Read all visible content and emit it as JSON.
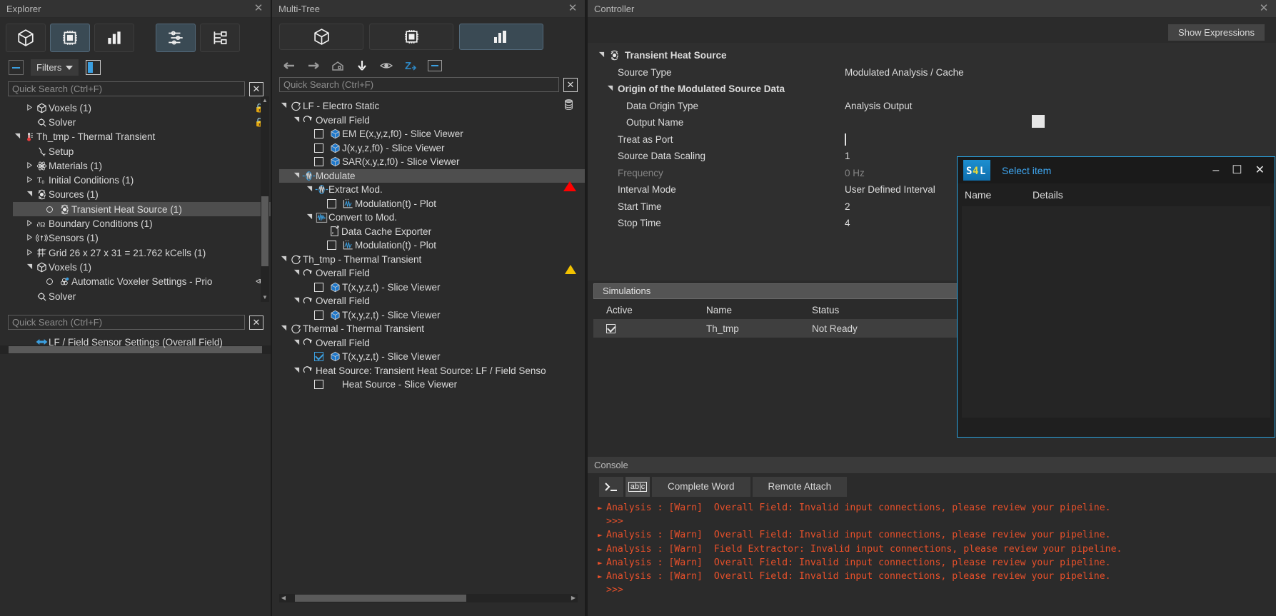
{
  "explorer": {
    "title": "Explorer",
    "tabs": [
      {
        "name": "model-tab",
        "icon": "cube-icon",
        "selected": false
      },
      {
        "name": "simulation-tab",
        "icon": "chip-icon",
        "selected": true
      },
      {
        "name": "results-tab",
        "icon": "bar-chart-icon",
        "selected": false
      },
      {
        "name": "settings-tab",
        "icon": "sliders-icon",
        "selected": true
      },
      {
        "name": "tree-tab",
        "icon": "tree-icon",
        "selected": false
      }
    ],
    "filters_label": "Filters",
    "search_placeholder": "Quick Search (Ctrl+F)",
    "search_value": "",
    "tree": [
      {
        "label": "Voxels (1)",
        "indent": 1,
        "twist": "collapsed",
        "icon": "cube-icon",
        "lock": true
      },
      {
        "label": "Solver",
        "indent": 1,
        "twist": "none",
        "icon": "solver-icon",
        "lock": true
      },
      {
        "label": "Th_tmp - Thermal Transient",
        "indent": 0,
        "twist": "expanded",
        "icon": "thermometer-icon"
      },
      {
        "label": "Setup",
        "indent": 1,
        "twist": "none",
        "icon": "setup-icon"
      },
      {
        "label": "Materials (1)",
        "indent": 1,
        "twist": "collapsed",
        "icon": "atom-icon"
      },
      {
        "label": "Initial Conditions (1)",
        "indent": 1,
        "twist": "collapsed",
        "icon": "t0-icon"
      },
      {
        "label": "Sources (1)",
        "indent": 1,
        "twist": "expanded",
        "icon": "source-icon"
      },
      {
        "label": "Transient Heat Source (1)",
        "indent": 2,
        "twist": "none",
        "icon": "source-icon",
        "radio": true,
        "selected": true
      },
      {
        "label": "Boundary Conditions (1)",
        "indent": 1,
        "twist": "collapsed",
        "icon": "domega-icon"
      },
      {
        "label": "Sensors (1)",
        "indent": 1,
        "twist": "collapsed",
        "icon": "sensor-icon"
      },
      {
        "label": "Grid 26 x 27 x 31 = 21.762 kCells (1)",
        "indent": 1,
        "twist": "collapsed",
        "icon": "grid-icon"
      },
      {
        "label": "Voxels (1)",
        "indent": 1,
        "twist": "expanded",
        "icon": "cube-icon"
      },
      {
        "label": "Automatic Voxeler Settings - Prio",
        "indent": 2,
        "twist": "none",
        "icon": "voxeler-icon",
        "radio": true,
        "eye": true
      },
      {
        "label": "Solver",
        "indent": 1,
        "twist": "none",
        "icon": "solver-icon"
      }
    ],
    "search2_placeholder": "Quick Search (Ctrl+F)",
    "lower_items": [
      {
        "label": "LF / Field Sensor Settings (Overall Field)",
        "icon": "arrows-icon"
      }
    ]
  },
  "multitree": {
    "title": "Multi-Tree",
    "tabs": [
      {
        "name": "model-tab",
        "icon": "cube-icon",
        "selected": false
      },
      {
        "name": "simulation-tab",
        "icon": "chip-icon",
        "selected": false
      },
      {
        "name": "results-tab",
        "icon": "bar-chart-icon",
        "selected": true
      }
    ],
    "toolbar": [
      {
        "name": "back-icon"
      },
      {
        "name": "forward-icon"
      },
      {
        "name": "home-icon"
      },
      {
        "name": "download-icon"
      },
      {
        "name": "eye-icon"
      },
      {
        "name": "z-sort-icon"
      },
      {
        "name": "collapse-icon"
      }
    ],
    "search_placeholder": "Quick Search (Ctrl+F)",
    "search_value": "",
    "tree": [
      {
        "label": "LF - Electro Static",
        "indent": 0,
        "twist": "expanded",
        "icon": "simulation-icon",
        "db": true
      },
      {
        "label": "Overall Field",
        "indent": 1,
        "twist": "expanded",
        "icon": "field-icon"
      },
      {
        "label": "EM E(x,y,z,f0) - Slice Viewer",
        "indent": 2,
        "twist": "none",
        "icon": "slice-icon",
        "check": false
      },
      {
        "label": "J(x,y,z,f0) - Slice Viewer",
        "indent": 2,
        "twist": "none",
        "icon": "slice-icon",
        "check": false
      },
      {
        "label": "SAR(x,y,z,f0) - Slice Viewer",
        "indent": 2,
        "twist": "none",
        "icon": "slice-icon",
        "check": false
      },
      {
        "label": "Modulate",
        "indent": 1,
        "twist": "expanded",
        "icon": "modulate-icon",
        "selected": true,
        "redflag": true
      },
      {
        "label": "Extract Mod.",
        "indent": 2,
        "twist": "expanded",
        "icon": "modulate-icon"
      },
      {
        "label": "Modulation(t) - Plot",
        "indent": 3,
        "twist": "none",
        "icon": "plot-icon",
        "check": false
      },
      {
        "label": "Convert to Mod.",
        "indent": 2,
        "twist": "expanded",
        "icon": "wave-icon"
      },
      {
        "label": "Data Cache Exporter",
        "indent": 3,
        "twist": "none",
        "icon": "export-icon"
      },
      {
        "label": "Modulation(t) - Plot",
        "indent": 3,
        "twist": "none",
        "icon": "plot-icon",
        "check": false
      },
      {
        "label": "Th_tmp - Thermal Transient",
        "indent": 0,
        "twist": "expanded",
        "icon": "simulation-icon",
        "warn": true
      },
      {
        "label": "Overall Field",
        "indent": 1,
        "twist": "expanded",
        "icon": "field-icon"
      },
      {
        "label": "T(x,y,z,t) - Slice Viewer",
        "indent": 2,
        "twist": "none",
        "icon": "slice-icon",
        "check": false
      },
      {
        "label": "Overall Field",
        "indent": 1,
        "twist": "expanded",
        "icon": "field-icon"
      },
      {
        "label": "T(x,y,z,t) - Slice Viewer",
        "indent": 2,
        "twist": "none",
        "icon": "slice-icon",
        "check": false
      },
      {
        "label": "Thermal - Thermal Transient",
        "indent": 0,
        "twist": "expanded",
        "icon": "simulation-icon"
      },
      {
        "label": "Overall Field",
        "indent": 1,
        "twist": "expanded",
        "icon": "field-icon"
      },
      {
        "label": "T(x,y,z,t) - Slice Viewer",
        "indent": 2,
        "twist": "none",
        "icon": "slice-icon",
        "check": true
      },
      {
        "label": "Heat Source: Transient Heat Source: LF / Field Senso",
        "indent": 1,
        "twist": "expanded",
        "icon": "field-icon"
      },
      {
        "label": "Heat Source - Slice Viewer",
        "indent": 2,
        "twist": "none",
        "icon": "",
        "check": false
      }
    ]
  },
  "controller": {
    "title": "Controller",
    "show_expressions_label": "Show Expressions",
    "properties": [
      {
        "name": "Transient Heat Source",
        "value": "",
        "indent": 0,
        "twist": "expanded",
        "header": true,
        "icon": "source-icon"
      },
      {
        "name": "Source Type",
        "value": "Modulated Analysis / Cache",
        "indent": 1
      },
      {
        "name": "Origin of the Modulated Source Data",
        "value": "",
        "indent": 1,
        "twist": "expanded",
        "header": true
      },
      {
        "name": "Data Origin Type",
        "value": "Analysis Output",
        "indent": 2
      },
      {
        "name": "Output Name",
        "value": "",
        "indent": 2,
        "browse": true
      },
      {
        "name": "Treat as Port",
        "value": "",
        "indent": 1,
        "checkbox": true
      },
      {
        "name": "Source Data Scaling",
        "value": "1",
        "indent": 1
      },
      {
        "name": "Frequency",
        "value": "0 Hz",
        "indent": 1,
        "disabled": true
      },
      {
        "name": "Interval Mode",
        "value": "User Defined Interval",
        "indent": 1
      },
      {
        "name": "Start Time",
        "value": "2",
        "indent": 1
      },
      {
        "name": "Stop Time",
        "value": "4",
        "indent": 1
      }
    ],
    "simulations_section": "Simulations",
    "sim_columns": [
      "Active",
      "Name",
      "Status"
    ],
    "sim_rows": [
      {
        "active": true,
        "name": "Th_tmp",
        "status": "Not Ready"
      }
    ]
  },
  "console": {
    "title": "Console",
    "buttons": [
      {
        "name": "terminal-icon",
        "label": ">_",
        "selected": false
      },
      {
        "name": "abc-icon",
        "label": "abc",
        "selected": true
      },
      {
        "name": "complete-word-button",
        "label": "Complete Word"
      },
      {
        "name": "remote-attach-button",
        "label": "Remote Attach"
      }
    ],
    "log": [
      {
        "bullet": true,
        "text": "Analysis : [Warn]  Overall Field: Invalid input connections, please review your pipeline."
      },
      {
        "bullet": false,
        "text": ">>>"
      },
      {
        "bullet": true,
        "text": "Analysis : [Warn]  Overall Field: Invalid input connections, please review your pipeline."
      },
      {
        "bullet": true,
        "text": "Analysis : [Warn]  Field Extractor: Invalid input connections, please review your pipeline."
      },
      {
        "bullet": true,
        "text": "Analysis : [Warn]  Overall Field: Invalid input connections, please review your pipeline."
      },
      {
        "bullet": true,
        "text": "Analysis : [Warn]  Overall Field: Invalid input connections, please review your pipeline."
      },
      {
        "bullet": false,
        "text": ">>>"
      }
    ]
  },
  "dialog": {
    "title": "Select item",
    "logo_text": "S4L",
    "columns": [
      "Name",
      "Details"
    ],
    "minimize_glyph": "–",
    "maximize_glyph": "☐",
    "close_glyph": "✕"
  },
  "colors": {
    "accent": "#3b9fe0",
    "warn": "#e8502a",
    "select": "#4e4e4e",
    "panel": "#2b2b2b",
    "yellow": "#f2c200",
    "red": "#ff0000"
  }
}
